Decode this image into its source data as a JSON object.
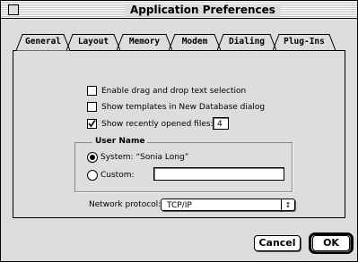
{
  "window": {
    "title": "Application Preferences"
  },
  "tabs": [
    {
      "label": "General",
      "selected": true
    },
    {
      "label": "Layout",
      "selected": false
    },
    {
      "label": "Memory",
      "selected": false
    },
    {
      "label": "Modem",
      "selected": false
    },
    {
      "label": "Dialing",
      "selected": false
    },
    {
      "label": "Plug-Ins",
      "selected": false
    }
  ],
  "options": [
    {
      "label": "Enable drag and drop text selection",
      "checked": false
    },
    {
      "label": "Show templates in New Database dialog",
      "checked": false
    },
    {
      "label": "Show recently opened files:",
      "checked": true
    }
  ],
  "recent_files_count": "4",
  "user_name": {
    "group_label": "User Name",
    "system_label": "System: “Sonia Long”",
    "custom_label": "Custom:",
    "custom_value": "",
    "selected": "system"
  },
  "network": {
    "label": "Network protocol:",
    "value": "TCP/IP"
  },
  "buttons": {
    "cancel": "Cancel",
    "ok": "OK"
  },
  "icons": [
    "close-box-icon",
    "checkmark-icon",
    "popup-arrows-icon"
  ]
}
